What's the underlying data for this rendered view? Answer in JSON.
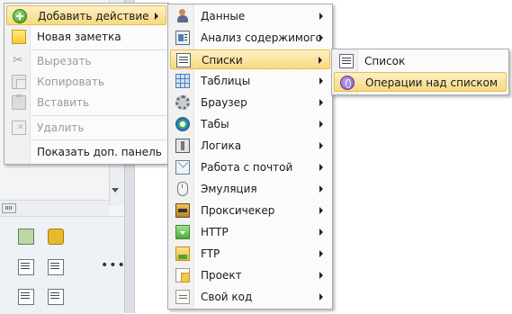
{
  "context_menu": {
    "items": [
      {
        "label": "Добавить действие",
        "icon": "add-icon",
        "submenu": true,
        "highlighted": true
      },
      {
        "label": "Новая заметка",
        "icon": "note-icon"
      },
      {
        "label": "Вырезать",
        "icon": "cut-icon",
        "disabled": true
      },
      {
        "label": "Копировать",
        "icon": "copy-icon",
        "disabled": true
      },
      {
        "label": "Вставить",
        "icon": "paste-icon",
        "disabled": true
      },
      {
        "label": "Удалить",
        "icon": "delete-icon",
        "disabled": true
      },
      {
        "label": "Показать доп. панель"
      }
    ]
  },
  "actions_submenu": {
    "items": [
      {
        "label": "Данные",
        "icon": "person-icon"
      },
      {
        "label": "Анализ содержимого",
        "icon": "analysis-icon"
      },
      {
        "label": "Списки",
        "icon": "list-icon",
        "highlighted": true
      },
      {
        "label": "Таблицы",
        "icon": "table-icon"
      },
      {
        "label": "Браузер",
        "icon": "gear-icon"
      },
      {
        "label": "Табы",
        "icon": "tabs-icon"
      },
      {
        "label": "Логика",
        "icon": "logic-icon"
      },
      {
        "label": "Работа с почтой",
        "icon": "mail-icon"
      },
      {
        "label": "Эмуляция",
        "icon": "mouse-icon"
      },
      {
        "label": "Проксичекер",
        "icon": "proxy-icon"
      },
      {
        "label": "HTTP",
        "icon": "http-icon"
      },
      {
        "label": "FTP",
        "icon": "ftp-icon"
      },
      {
        "label": "Проект",
        "icon": "project-icon"
      },
      {
        "label": "Свой код",
        "icon": "code-icon"
      }
    ]
  },
  "lists_submenu": {
    "items": [
      {
        "label": "Список",
        "icon": "list-icon"
      },
      {
        "label": "Операции над списком",
        "icon": "list-operations-icon",
        "highlighted": true
      }
    ]
  },
  "colors": {
    "highlight": "#f7d97f",
    "highlight_border": "#e7bd4d",
    "menu_background": "#fbfbfb",
    "disabled_text": "#9a9a9a"
  }
}
